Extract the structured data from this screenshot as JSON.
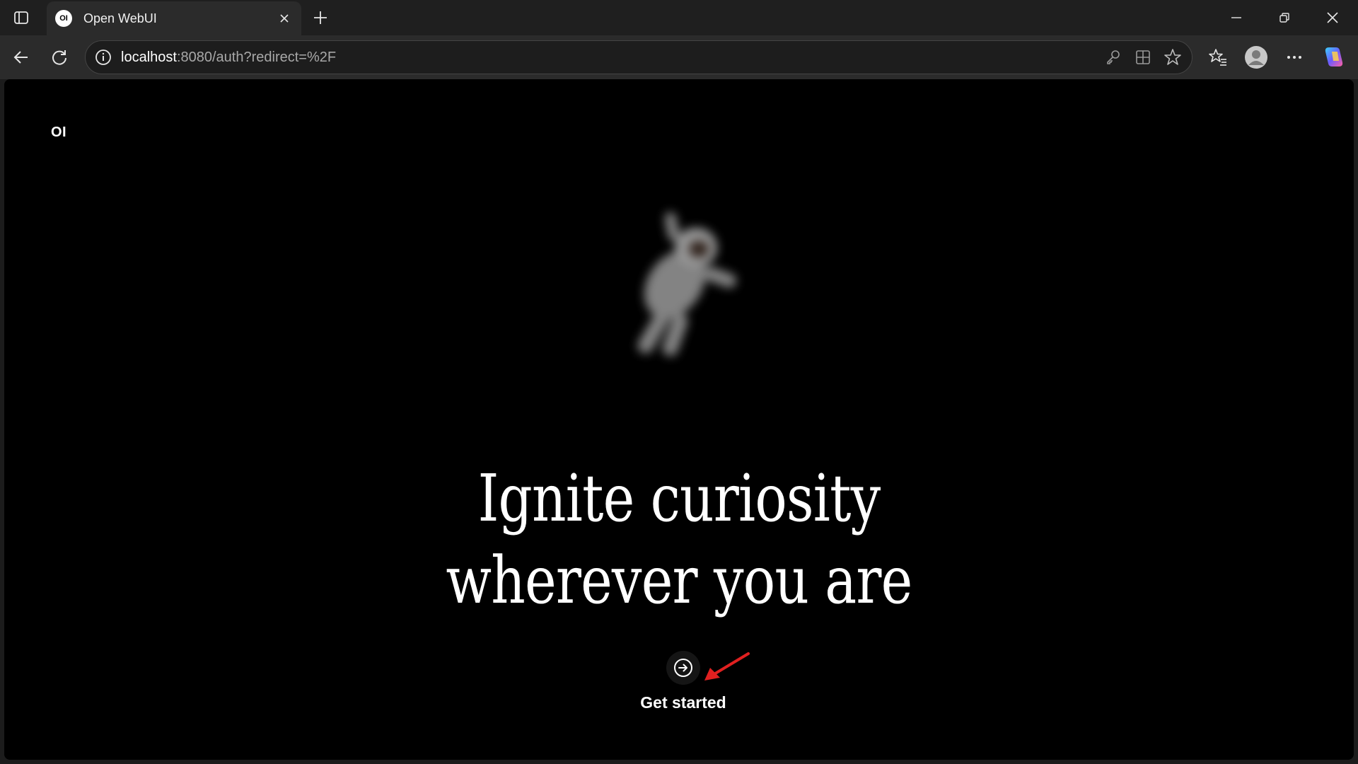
{
  "browser": {
    "tab": {
      "favicon_text": "OI",
      "title": "Open WebUI"
    },
    "address": {
      "host": "localhost",
      "rest": ":8080/auth?redirect=%2F"
    },
    "colors": {
      "chrome": "#1f1f1f",
      "toolbar": "#2b2b2b",
      "page": "#000000"
    },
    "icons": [
      "tab-actions-icon",
      "close-icon",
      "plus-icon",
      "minimize-icon",
      "restore-icon",
      "window-close-icon",
      "back-icon",
      "refresh-icon",
      "info-icon",
      "key-icon",
      "apps-icon",
      "star-icon",
      "favorites-icon",
      "profile-avatar-icon",
      "more-icon",
      "copilot-icon"
    ]
  },
  "page": {
    "logo": "OI",
    "headline_line1": "Ignite curiosity",
    "headline_line2": "wherever you are",
    "cta_label": "Get started",
    "annotation_color": "#e02020"
  }
}
